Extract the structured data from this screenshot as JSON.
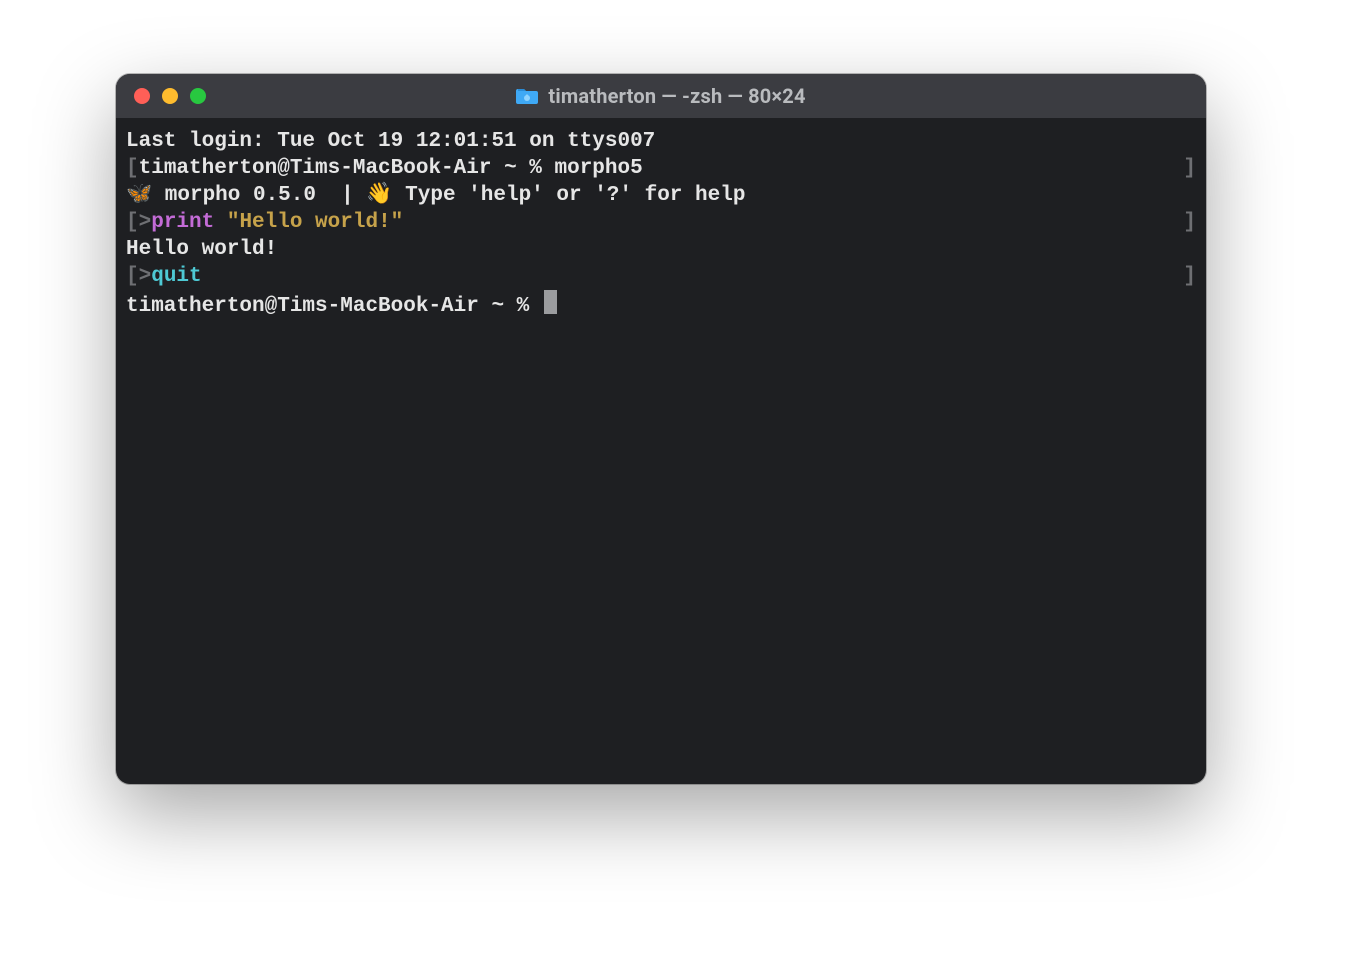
{
  "window": {
    "title": "timatherton — -zsh — 80×24"
  },
  "terminal": {
    "line1": "Last login: Tue Oct 19 12:01:51 on ttys007",
    "line2_left_open": "[",
    "line2_prompt": "timatherton@Tims-MacBook-Air ~ % ",
    "line2_cmd": "morpho5",
    "line2_right": "]",
    "line3_emoji1": "🦋",
    "line3_text1": " morpho 0.5.0  | ",
    "line3_emoji2": "👋",
    "line3_text2": " Type 'help' or '?' for help",
    "line4_open": "[",
    "line4_gt": ">",
    "line4_kw": "print",
    "line4_sp": " ",
    "line4_str": "\"Hello world!\"",
    "line4_right": "]",
    "line5": "Hello world!",
    "line6_open": "[",
    "line6_gt": ">",
    "line6_cmd": "quit",
    "line6_right": "]",
    "line7_prompt": "timatherton@Tims-MacBook-Air ~ % "
  }
}
